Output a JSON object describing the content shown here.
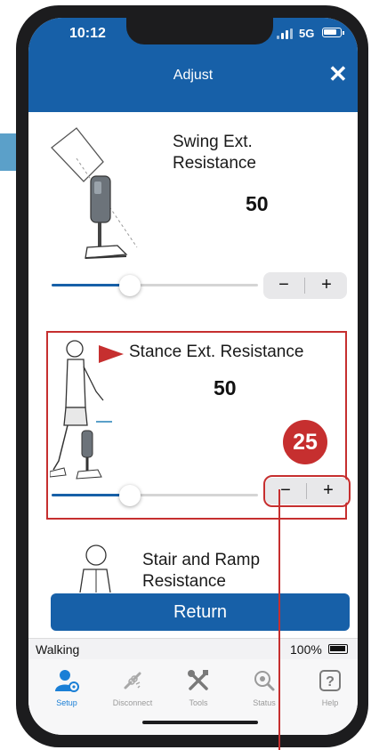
{
  "status_bar": {
    "time": "10:12",
    "network": "5G"
  },
  "header": {
    "title": "Adjust",
    "close_symbol": "✕"
  },
  "settings": [
    {
      "label_line1": "Swing Ext.",
      "label_line2": "Resistance",
      "value": "50",
      "slider_fraction": 0.38,
      "minus": "−",
      "plus": "+"
    },
    {
      "label": "Stance Ext. Resistance",
      "value": "50",
      "slider_fraction": 0.38,
      "minus": "−",
      "plus": "+"
    },
    {
      "label_line1": "Stair and Ramp",
      "label_line2": "Resistance"
    }
  ],
  "annotation": {
    "number": "25",
    "color": "#c62f2f"
  },
  "return_button": {
    "label": "Return"
  },
  "device_status": {
    "mode": "Walking",
    "battery": "100%"
  },
  "tabs": [
    {
      "label": "Setup",
      "icon": "user-gear-icon",
      "active": true
    },
    {
      "label": "Disconnect",
      "icon": "disconnect-icon",
      "active": false
    },
    {
      "label": "Tools",
      "icon": "tools-icon",
      "active": false
    },
    {
      "label": "Status",
      "icon": "status-icon",
      "active": false
    },
    {
      "label": "Help",
      "icon": "help-icon",
      "active": false
    }
  ],
  "colors": {
    "brand_blue": "#1760a8",
    "annotation_red": "#c62f2f",
    "active_tab": "#1a7fd6"
  }
}
